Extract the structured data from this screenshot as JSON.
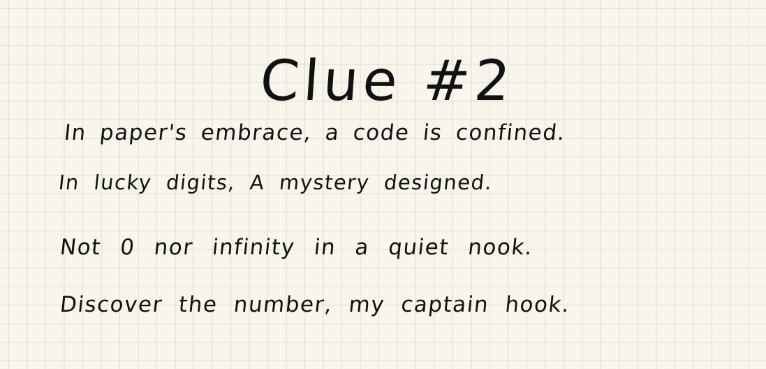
{
  "title": "Clue #2",
  "poem": {
    "lines": [
      "In paper's embrace, a code is confined.",
      "In lucky digits, A mystery designed.",
      "Not 0 nor infinity in a quiet nook.",
      "Discover the number, my captain hook."
    ]
  }
}
